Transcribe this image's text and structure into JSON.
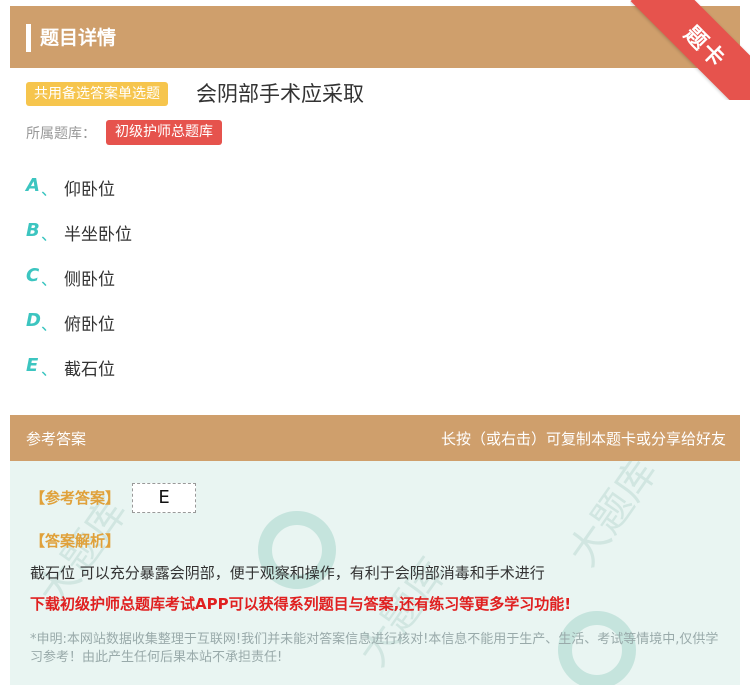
{
  "header": {
    "title": "题目详情",
    "ribbon": "题卡"
  },
  "question": {
    "type_tag": "共用备选答案单选题",
    "text": "会阴部手术应采取",
    "library_label": "所属题库：",
    "library_tag": "初级护师总题库",
    "options": [
      {
        "letter": "A",
        "sep": "、",
        "text": "仰卧位"
      },
      {
        "letter": "B",
        "sep": "、",
        "text": "半坐卧位"
      },
      {
        "letter": "C",
        "sep": "、",
        "text": "侧卧位"
      },
      {
        "letter": "D",
        "sep": "、",
        "text": "俯卧位"
      },
      {
        "letter": "E",
        "sep": "、",
        "text": "截石位"
      }
    ]
  },
  "answer": {
    "head_left": "参考答案",
    "head_right": "长按（或右击）可复制本题卡或分享给好友",
    "answer_label": "【参考答案】",
    "answer_value": "E",
    "explanation_label": "【答案解析】",
    "explanation": "截石位 可以充分暴露会阴部，便于观察和操作，有利于会阴部消毒和手术进行",
    "promo": "下载初级护师总题库考试APP可以获得系列题目与答案,还有练习等更多学习功能!",
    "disclaimer": "*申明:本网站数据收集整理于互联网!我们并未能对答案信息进行核对!本信息不能用于生产、生活、考试等情境中,仅供学习参考！由此产生任何后果本站不承担责任!"
  },
  "colors": {
    "header": "#cf9f6c",
    "accent": "#3cc5c0",
    "tag_red": "#e6534d",
    "tag_yellow": "#f6c54d",
    "panel_bg": "#e9f5f2"
  }
}
